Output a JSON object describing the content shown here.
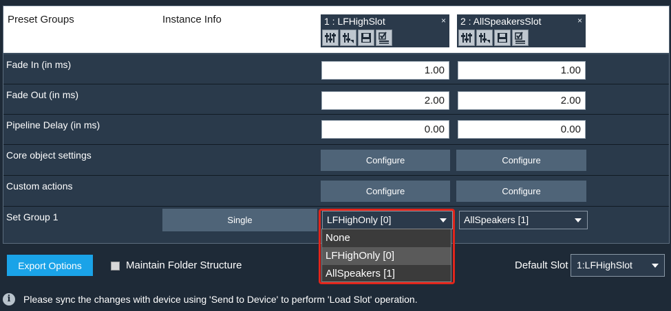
{
  "header": {
    "preset_groups_label": "Preset Groups",
    "instance_info_label": "Instance Info"
  },
  "slots": [
    {
      "title": "1 : LFHighSlot",
      "close": "×"
    },
    {
      "title": "2 : AllSpeakersSlot",
      "close": "×"
    }
  ],
  "slot_icons": [
    "mixer-sliders-icon",
    "mixer-sliders-arrow-icon",
    "save-icon",
    "checklist-icon"
  ],
  "rows": {
    "fade_in": {
      "label": "Fade In (in ms)",
      "values": [
        "1.00",
        "1.00"
      ]
    },
    "fade_out": {
      "label": "Fade Out (in ms)",
      "values": [
        "2.00",
        "2.00"
      ]
    },
    "pipeline_delay": {
      "label": "Pipeline Delay (in ms)",
      "values": [
        "0.00",
        "0.00"
      ]
    },
    "core_object": {
      "label": "Core object settings",
      "button": "Configure"
    },
    "custom_actions": {
      "label": "Custom actions",
      "button": "Configure"
    },
    "set_group": {
      "label": "Set Group 1",
      "mode_button": "Single",
      "slot_values": [
        "LFHighOnly [0]",
        "AllSpeakers [1]"
      ]
    }
  },
  "dropdown": {
    "options": [
      "None",
      "LFHighOnly [0]",
      "AllSpeakers [1]"
    ],
    "selected": "LFHighOnly [0]",
    "highlight_color": "#e1251b"
  },
  "footer": {
    "export_label": "Export Options",
    "maintain_folder_label": "Maintain Folder Structure",
    "maintain_folder_checked": false,
    "default_slot_label": "Default Slot",
    "default_slot_value": "1:LFHighSlot",
    "info_message": "Please sync the changes with device using 'Send to Device' to perform 'Load Slot' operation."
  },
  "colors": {
    "background": "#1e2a37",
    "panel": "#2a3a4b",
    "button": "#4f6478",
    "accent": "#1aa3e8"
  }
}
